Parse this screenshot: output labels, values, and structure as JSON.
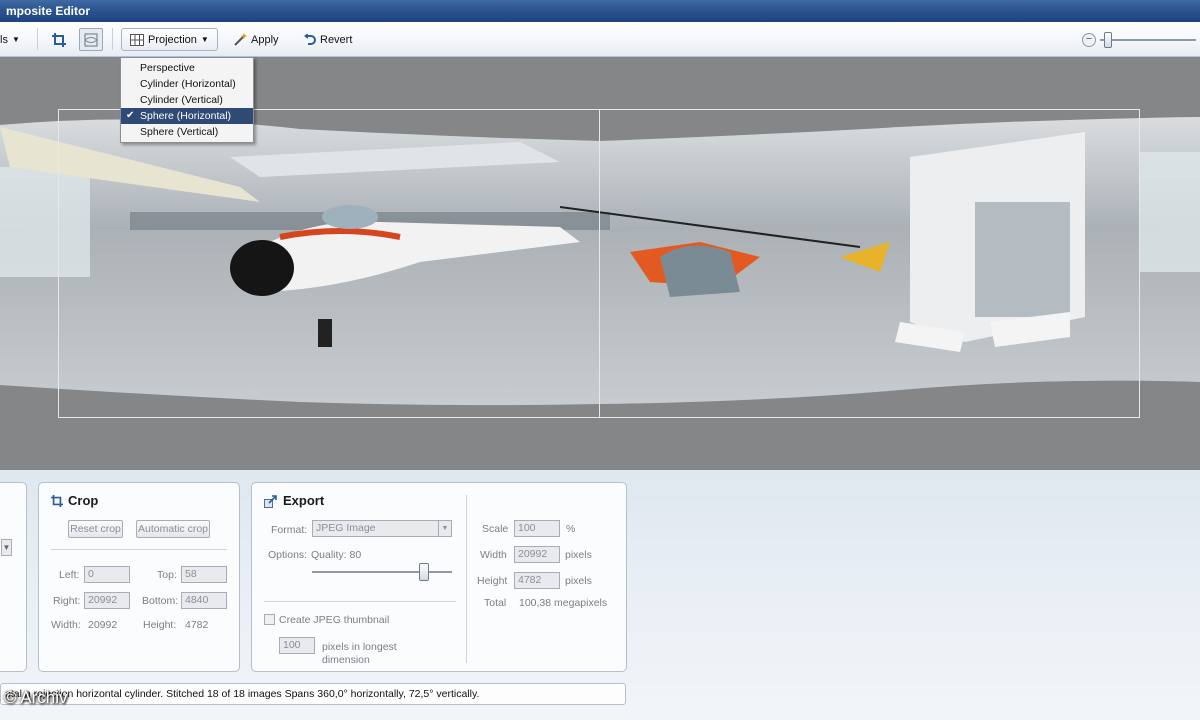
{
  "window": {
    "title": "mposite Editor"
  },
  "toolbar": {
    "tools_label": "ls",
    "projection_label": "Projection",
    "apply_label": "Apply",
    "revert_label": "Revert"
  },
  "projection_menu": {
    "items": [
      {
        "label": "Perspective",
        "checked": false
      },
      {
        "label": "Cylinder (Horizontal)",
        "checked": false
      },
      {
        "label": "Cylinder (Vertical)",
        "checked": false
      },
      {
        "label": "Sphere (Horizontal)",
        "checked": true
      },
      {
        "label": "Sphere (Vertical)",
        "checked": false
      }
    ]
  },
  "crop": {
    "title": "Crop",
    "reset_label": "Reset crop",
    "auto_label": "Automatic crop",
    "left_label": "Left:",
    "left_value": "0",
    "top_label": "Top:",
    "top_value": "58",
    "right_label": "Right:",
    "right_value": "20992",
    "bottom_label": "Bottom:",
    "bottom_value": "4840",
    "width_label": "Width:",
    "width_value": "20992",
    "height_label": "Height:",
    "height_value": "4782"
  },
  "export": {
    "title": "Export",
    "format_label": "Format:",
    "format_value": "JPEG Image",
    "options_label": "Options:",
    "quality_label": "Quality: 80",
    "quality": 80,
    "thumbnail_label": "Create JPEG thumbnail",
    "thumbnail_size": "100",
    "thumbnail_unit": "pixels in longest dimension",
    "scale_label": "Scale",
    "scale_value": "100",
    "scale_unit": "%",
    "width_label": "Width",
    "width_value": "20992",
    "width_unit": "pixels",
    "height_label": "Height",
    "height_value": "4782",
    "height_unit": "pixels",
    "total_label": "Total",
    "total_value": "100,38 megapixels"
  },
  "status": {
    "text": "otal   n  rojection  horizontal cylinder. Stitched 18 of 18 images  Spans 360,0° horizontally, 72,5° vertically."
  },
  "watermark": {
    "text": "© Archiv"
  },
  "colors": {
    "titlebar": "#2b5490",
    "canvas": "#848688",
    "menu_selected": "#2e4a75"
  }
}
